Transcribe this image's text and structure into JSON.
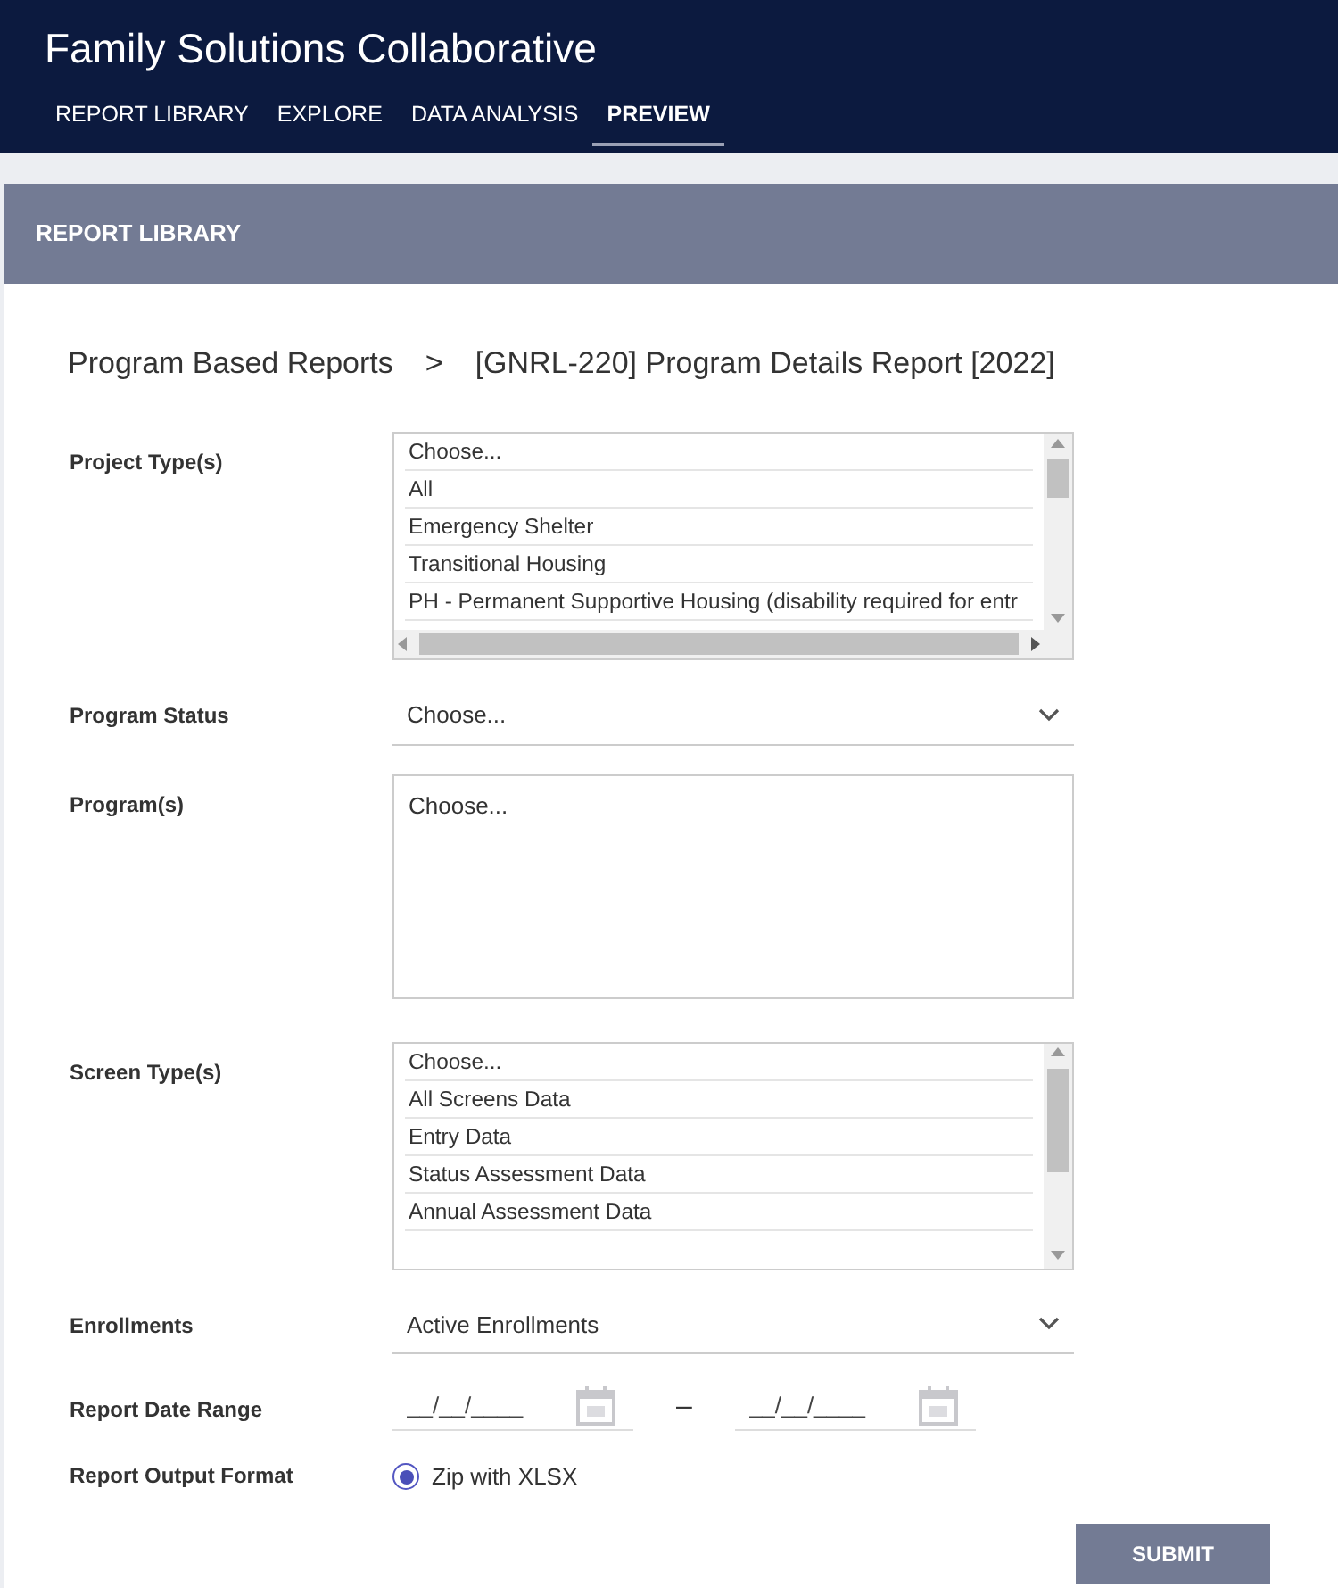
{
  "app": {
    "title": "Family Solutions Collaborative"
  },
  "nav": [
    {
      "label": "REPORT LIBRARY",
      "selected": false
    },
    {
      "label": "EXPLORE",
      "selected": false
    },
    {
      "label": "DATA ANALYSIS",
      "selected": false
    },
    {
      "label": "PREVIEW",
      "selected": true
    }
  ],
  "panel": {
    "title": "REPORT LIBRARY"
  },
  "breadcrumb": [
    "Program Based Reports",
    ">",
    "[GNRL-220] Program Details Report [2022]"
  ],
  "fields": [
    {
      "label": "Project Type(s)",
      "kind": "listbox",
      "hscroll": true,
      "options": [
        "Choose...",
        "All",
        "Emergency Shelter",
        "Transitional Housing",
        "PH - Permanent Supportive Housing (disability required for entr"
      ]
    },
    {
      "label": "Program Status",
      "kind": "select",
      "value": "Choose..."
    },
    {
      "label": "Program(s)",
      "kind": "textarea",
      "placeholder": "Choose..."
    },
    {
      "label": "Screen Type(s)",
      "kind": "listbox",
      "hscroll": false,
      "options": [
        "Choose...",
        "All Screens Data",
        "Entry Data",
        "Status Assessment Data",
        "Annual Assessment Data"
      ]
    },
    {
      "label": "Enrollments",
      "kind": "select",
      "value": "Active Enrollments"
    },
    {
      "label": "Report Date Range",
      "kind": "daterange",
      "from_placeholder": "__/__/____",
      "separator": "–",
      "to_placeholder": "__/__/____"
    },
    {
      "label": "Report Output Format",
      "kind": "radio",
      "options": [
        {
          "label": "Zip with XLSX",
          "selected": true
        }
      ]
    }
  ],
  "submit": "SUBMIT"
}
